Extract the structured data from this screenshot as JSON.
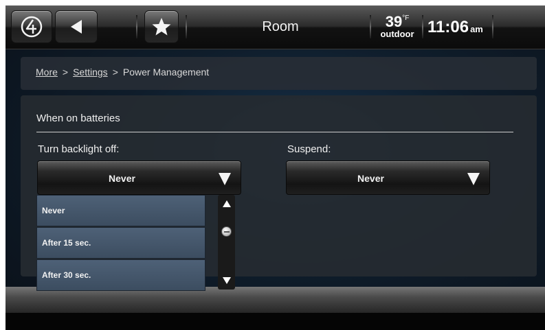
{
  "topbar": {
    "title": "Room",
    "temperature": "39",
    "temp_degree": "°",
    "temp_unit": "F",
    "temp_label": "outdoor",
    "time": "11:06",
    "ampm": "am"
  },
  "breadcrumb": {
    "items": [
      "More",
      "Settings",
      "Power Management"
    ],
    "separator": ">"
  },
  "section": {
    "title": "When on batteries"
  },
  "backlight": {
    "label": "Turn backlight off:",
    "value": "Never",
    "options": [
      "Never",
      "After 15 sec.",
      "After 30 sec."
    ]
  },
  "suspend": {
    "label": "Suspend:",
    "value": "Never"
  },
  "icons": {
    "home": "home-logo-icon",
    "back": "back-arrow-icon",
    "favorite": "star-icon",
    "dropdown": "triangle-down-icon"
  }
}
